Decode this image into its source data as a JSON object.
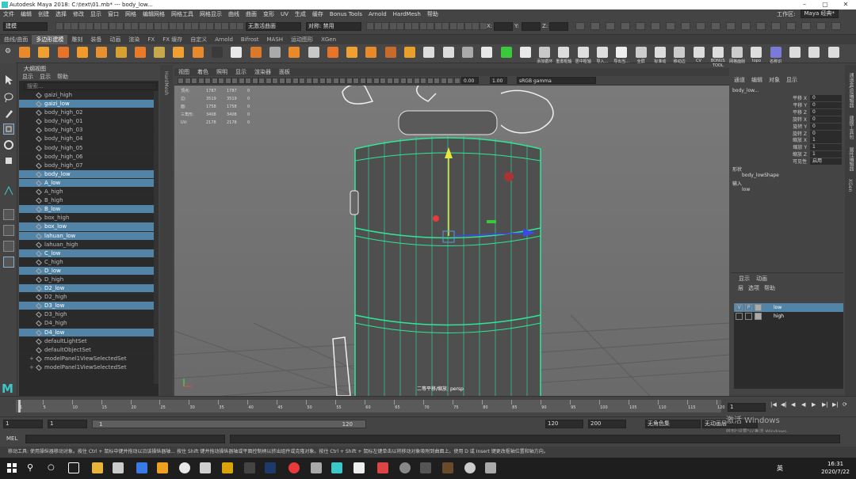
{
  "title": "Autodesk Maya 2018: C:\\text\\01.mb*   ---   body_low...",
  "menu": [
    "文件",
    "编辑",
    "创建",
    "选择",
    "修改",
    "显示",
    "窗口",
    "网格",
    "编辑网格",
    "网格工具",
    "网格显示",
    "曲线",
    "曲面",
    "变形",
    "UV",
    "生成",
    "缓存",
    "Bonus Tools",
    "Arnold",
    "HardMesh",
    "帮助"
  ],
  "workspace": {
    "label": "工作区:",
    "value": "Maya 经典*"
  },
  "status": {
    "mode": "建模",
    "live": "无激活曲面",
    "symmetry_label": "对称: 禁用",
    "x": "X:",
    "y": "Y:",
    "z": "Z:"
  },
  "shelf_tabs": [
    "曲线/曲面",
    "多边形建模",
    "雕刻",
    "装备",
    "动画",
    "渲染",
    "FX",
    "FX 缓存",
    "自定义",
    "Arnold",
    "Bifrost",
    "MASH",
    "运动图形",
    "XGen"
  ],
  "shelf_active": 1,
  "shelf_labels": [
    "添加循环",
    "重置枢轴",
    "居中枢轴",
    "导入…",
    "导出当…",
    "全屏",
    "标准动",
    "移动边",
    "CV",
    "BONUS TOOL SENBE",
    "网格面削",
    "topo",
    "名称识"
  ],
  "outliner": {
    "title": "大纲视图",
    "menu": [
      "显示",
      "显示",
      "帮助"
    ],
    "search": "搜索...",
    "items": [
      {
        "name": "gaizi_high",
        "sel": false
      },
      {
        "name": "gaizi_low",
        "sel": true
      },
      {
        "name": "body_high_02",
        "sel": false
      },
      {
        "name": "body_high_01",
        "sel": false
      },
      {
        "name": "body_high_03",
        "sel": false
      },
      {
        "name": "body_high_04",
        "sel": false
      },
      {
        "name": "body_high_05",
        "sel": false
      },
      {
        "name": "body_high_06",
        "sel": false
      },
      {
        "name": "body_high_07",
        "sel": false
      },
      {
        "name": "body_low",
        "sel": true
      },
      {
        "name": "A_low",
        "sel": true
      },
      {
        "name": "A_high",
        "sel": false
      },
      {
        "name": "B_high",
        "sel": false
      },
      {
        "name": "B_low",
        "sel": true
      },
      {
        "name": "box_high",
        "sel": false
      },
      {
        "name": "box_low",
        "sel": true
      },
      {
        "name": "lahuan_low",
        "sel": true
      },
      {
        "name": "lahuan_high",
        "sel": false
      },
      {
        "name": "C_low",
        "sel": true
      },
      {
        "name": "C_high",
        "sel": false
      },
      {
        "name": "D_low",
        "sel": true
      },
      {
        "name": "D_high",
        "sel": false
      },
      {
        "name": "D2_low",
        "sel": true
      },
      {
        "name": "D2_high",
        "sel": false
      },
      {
        "name": "D3_low",
        "sel": true
      },
      {
        "name": "D3_high",
        "sel": false
      },
      {
        "name": "D4_high",
        "sel": false
      },
      {
        "name": "D4_low",
        "sel": true
      },
      {
        "name": "defaultLightSet",
        "sel": false
      },
      {
        "name": "defaultObjectSet",
        "sel": false
      },
      {
        "name": "modelPanel1ViewSelectedSet",
        "sel": false
      },
      {
        "name": "modelPanel1ViewSelectedSet",
        "sel": false
      }
    ]
  },
  "hypershade_tab": "HardMesh",
  "viewport": {
    "menu": [
      "视图",
      "着色",
      "照明",
      "显示",
      "渲染器",
      "面板"
    ],
    "field1": "0.00",
    "field2": "1.00",
    "colorspace": "sRGB gamma",
    "hud": [
      [
        "顶点:",
        "1787",
        "1787",
        "0"
      ],
      [
        "边:",
        "3519",
        "3519",
        "0"
      ],
      [
        "面:",
        "1758",
        "1758",
        "0"
      ],
      [
        "三角形:",
        "3408",
        "3408",
        "0"
      ],
      [
        "UV:",
        "2178",
        "2178",
        "0"
      ]
    ],
    "camera": "二等平移/缩放: persp"
  },
  "channelbox": {
    "tabs": [
      "通道",
      "编辑",
      "对象",
      "显示"
    ],
    "object": "body_low...",
    "channels": [
      {
        "label": "平移 X",
        "value": "0"
      },
      {
        "label": "平移 Y",
        "value": "0"
      },
      {
        "label": "平移 Z",
        "value": "0"
      },
      {
        "label": "旋转 X",
        "value": "0"
      },
      {
        "label": "旋转 Y",
        "value": "0"
      },
      {
        "label": "旋转 Z",
        "value": "0"
      },
      {
        "label": "缩放 X",
        "value": "1"
      },
      {
        "label": "缩放 Y",
        "value": "1"
      },
      {
        "label": "缩放 Z",
        "value": "1"
      },
      {
        "label": "可见性",
        "value": "启用"
      }
    ],
    "shapes_label": "形状",
    "shape": "body_lowShape",
    "inputs_label": "输入",
    "input": "low"
  },
  "layers": {
    "tabs": [
      "显示",
      "动画"
    ],
    "menu": [
      "层",
      "选项",
      "帮助"
    ],
    "items": [
      {
        "v": "V",
        "p": "P",
        "name": "low",
        "sel": true
      },
      {
        "v": "",
        "p": "",
        "name": "high",
        "sel": false
      }
    ]
  },
  "side_tabs": [
    "通道盒/层编辑器",
    "建模工具包",
    "属性编辑器",
    "XGen"
  ],
  "timeline": {
    "ticks": [
      "1",
      "5",
      "10",
      "15",
      "20",
      "25",
      "30",
      "35",
      "40",
      "45",
      "50",
      "55",
      "60",
      "65",
      "70",
      "75",
      "80",
      "85",
      "90",
      "95",
      "100",
      "105",
      "110",
      "115",
      "120"
    ],
    "current": "1"
  },
  "range": {
    "start": "1",
    "start2": "1",
    "slider_start": "1",
    "slider_end": "120",
    "end": "120",
    "end2": "200",
    "char_set": "无角色集",
    "anim_layer": "无动画层"
  },
  "cmd_label": "MEL",
  "help_line": "移动工具: 使用操纵器移动对象。按住 Ctrl + 鼠标中键并拖动以沿该操纵器轴... 按住 Shift 键并拖动操纵器轴或平面控制柄以挤出组件或克隆对象。按住 Ctrl + Shift + 鼠标左键单击以将移动对象吸附到曲面上。使用 D 或 Insert 键更改枢轴位置和轴方向。",
  "activate": {
    "line1": "激活 Windows",
    "line2": "转到\"设置\"以激活 Windows。"
  },
  "taskbar": {
    "time": "16:31",
    "date": "2020/7/22",
    "lang": "英"
  },
  "colors": {
    "selection": "#5284a8",
    "wire": "#2ee89a",
    "accent": "#3cc8c8"
  }
}
